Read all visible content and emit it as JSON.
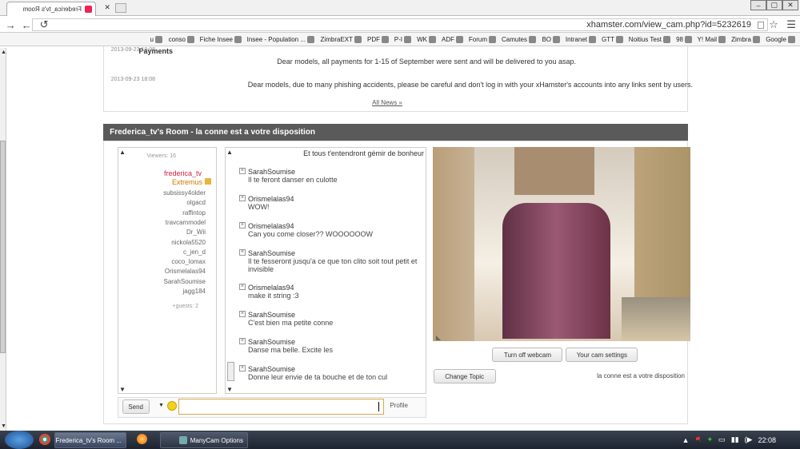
{
  "browser": {
    "tab_title": "Frederica_tv's Room",
    "url": "xhamster.com/view_cam.php?id=5232619",
    "bookmarks": [
      "Google",
      "Zimbra",
      "Y! Mail",
      "98",
      "Noitius Test",
      "GTT",
      "Intranet",
      "BO",
      "Camutes",
      "Forum",
      "ADF",
      "WK",
      "P-I",
      "PDF",
      "ZimbraEXT",
      "Insee - Population ...",
      "Fiche Insee",
      "conso",
      "u"
    ]
  },
  "news": {
    "title_fragment": "Payments",
    "line1": "Dear models, all payments for 1-15 of September were sent and will be delivered to you asap.",
    "line2": "Dear models, due to many phishing accidents, please be careful and don't log in with your xHamster's accounts into any links sent by users.",
    "date2": "2013-09-23 18:08",
    "date1": "2013-09-23 18:08",
    "all_news": "All News »"
  },
  "room": {
    "header": "Frederica_tv's Room - la conne est a votre disposition",
    "topic": "la conne est a votre disposition",
    "change_topic": "Change Topic",
    "cam_settings": "Your cam settings",
    "turn_off": "Turn off webcam",
    "viewers_label": "Viewers: 16",
    "guests_label": "+guests: 2",
    "send": "Send",
    "profile": "Profile"
  },
  "chat": {
    "first_line": "Et tous t'entendront gémir de bonheur",
    "messages": [
      {
        "name": "SarahSoumise",
        "text": "Il te feront danser en culotte"
      },
      {
        "name": "Orismelalas94",
        "text": "WOW!"
      },
      {
        "name": "Orismelalas94",
        "text": "Can you come closer?? WOOOOOOW"
      },
      {
        "name": "SarahSoumise",
        "text": "Il te fesseront jusqu'a ce que ton clito soit tout petit et invisible"
      },
      {
        "name": "Orismelalas94",
        "text": "make it string :3"
      },
      {
        "name": "SarahSoumise",
        "text": "C'est bien ma petite conne"
      },
      {
        "name": "SarahSoumise",
        "text": "Danse ma belle. Excite les"
      },
      {
        "name": "SarahSoumise",
        "text": "Donne leur envie de ta bouche et de ton cul"
      }
    ]
  },
  "users": {
    "owner": "frederica_tv",
    "owner_group": "Extremus",
    "list": [
      "subsissy4older",
      "olgacd",
      "raffintop",
      "travcammodel",
      "Dr_Wii",
      "nickola5520",
      "c_jen_d",
      "coco_lomax",
      "Orismelalas94",
      "SarahSoumise",
      "jagg184"
    ]
  },
  "taskbar": {
    "time": "22:08",
    "btn_browser": "Frederica_tv's Room ...",
    "btn_manycam": "ManyCam Options"
  }
}
